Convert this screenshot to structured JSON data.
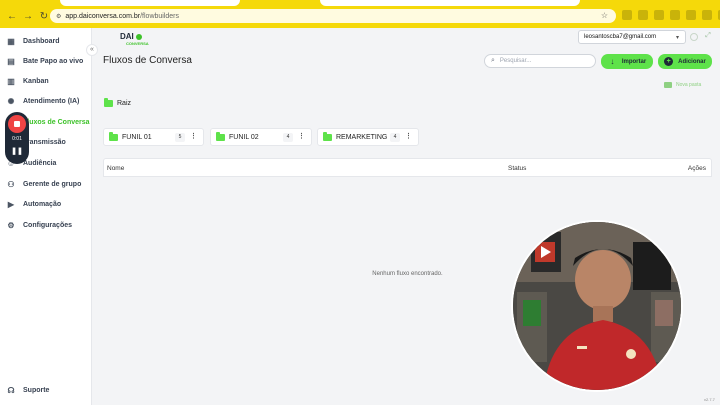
{
  "browser": {
    "url_host": "app.daiconversa.com.br",
    "url_path": "/flowbuilders"
  },
  "sidebar": {
    "items": [
      {
        "label": "Dashboard",
        "icon": "dashboard-icon"
      },
      {
        "label": "Bate Papo ao vivo",
        "icon": "chat-icon"
      },
      {
        "label": "Kanban",
        "icon": "kanban-icon"
      },
      {
        "label": "Atendimento (IA)",
        "icon": "ai-icon"
      },
      {
        "label": "Fluxos de Conversa",
        "icon": "flow-icon",
        "active": true
      },
      {
        "label": "Transmissão",
        "icon": "broadcast-icon"
      },
      {
        "label": "Audiência",
        "icon": "audience-icon"
      },
      {
        "label": "Gerente de grupo",
        "icon": "group-icon"
      },
      {
        "label": "Automação",
        "icon": "automation-icon"
      },
      {
        "label": "Configurações",
        "icon": "gear-icon"
      }
    ],
    "support_label": "Suporte"
  },
  "recording": {
    "time": "0:01"
  },
  "logo": {
    "name": "DAI",
    "sub": "CONVERSA"
  },
  "header": {
    "user_email": "leosantoscba7@gmail.com",
    "title": "Fluxos de Conversa",
    "search_placeholder": "Pesquisar...",
    "import_label": "Importar",
    "add_label": "Adicionar",
    "new_folder_label": "Nova pasta"
  },
  "breadcrumb": {
    "root": "Raiz"
  },
  "folders": [
    {
      "name": "FUNIL 01",
      "count": "5"
    },
    {
      "name": "FUNIL 02",
      "count": "4"
    },
    {
      "name": "REMARKETING",
      "count": "4"
    }
  ],
  "table": {
    "col_name": "Nome",
    "col_status": "Status",
    "col_actions": "Ações",
    "empty_message": "Nenhum fluxo encontrado."
  },
  "version": "v2.7.7",
  "colors": {
    "accent": "#5ee24a",
    "chrome": "#f5d90a"
  }
}
